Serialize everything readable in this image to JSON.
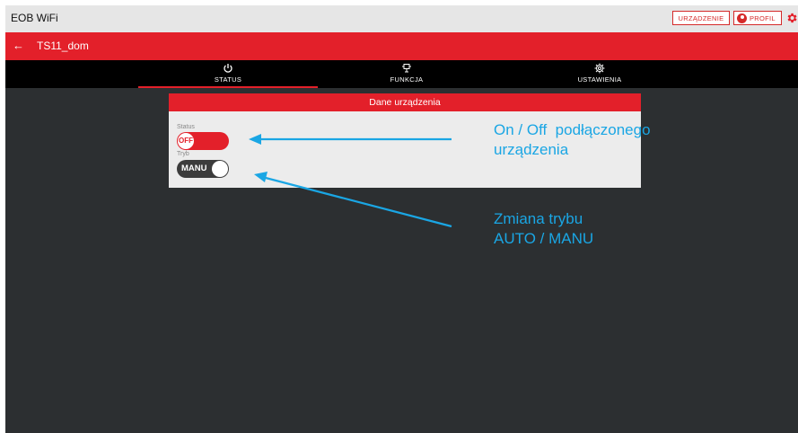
{
  "app": {
    "title": "EOB WiFi"
  },
  "topbar": {
    "device_button": "URZĄDZENIE",
    "profile_button": "PROFIL"
  },
  "device": {
    "name": "TS11_dom"
  },
  "tabs": [
    {
      "label": "STATUS",
      "icon": "power-icon",
      "active": true
    },
    {
      "label": "FUNKCJA",
      "icon": "function-icon",
      "active": false
    },
    {
      "label": "USTAWIENIA",
      "icon": "settings-icon",
      "active": false
    }
  ],
  "card": {
    "title": "Dane urządzenia",
    "status_label": "Status",
    "status_value": "OFF",
    "mode_label": "Tryb",
    "mode_value": "MANU"
  },
  "annotations": {
    "onoff_line1": "On / Off  podłączonego",
    "onoff_line2": "urządzenia",
    "mode_line1": "Zmiana trybu",
    "mode_line2": "AUTO / MANU"
  },
  "colors": {
    "accent": "#e3202a",
    "background": "#2c2f31",
    "annotation": "#1aa6e4"
  }
}
